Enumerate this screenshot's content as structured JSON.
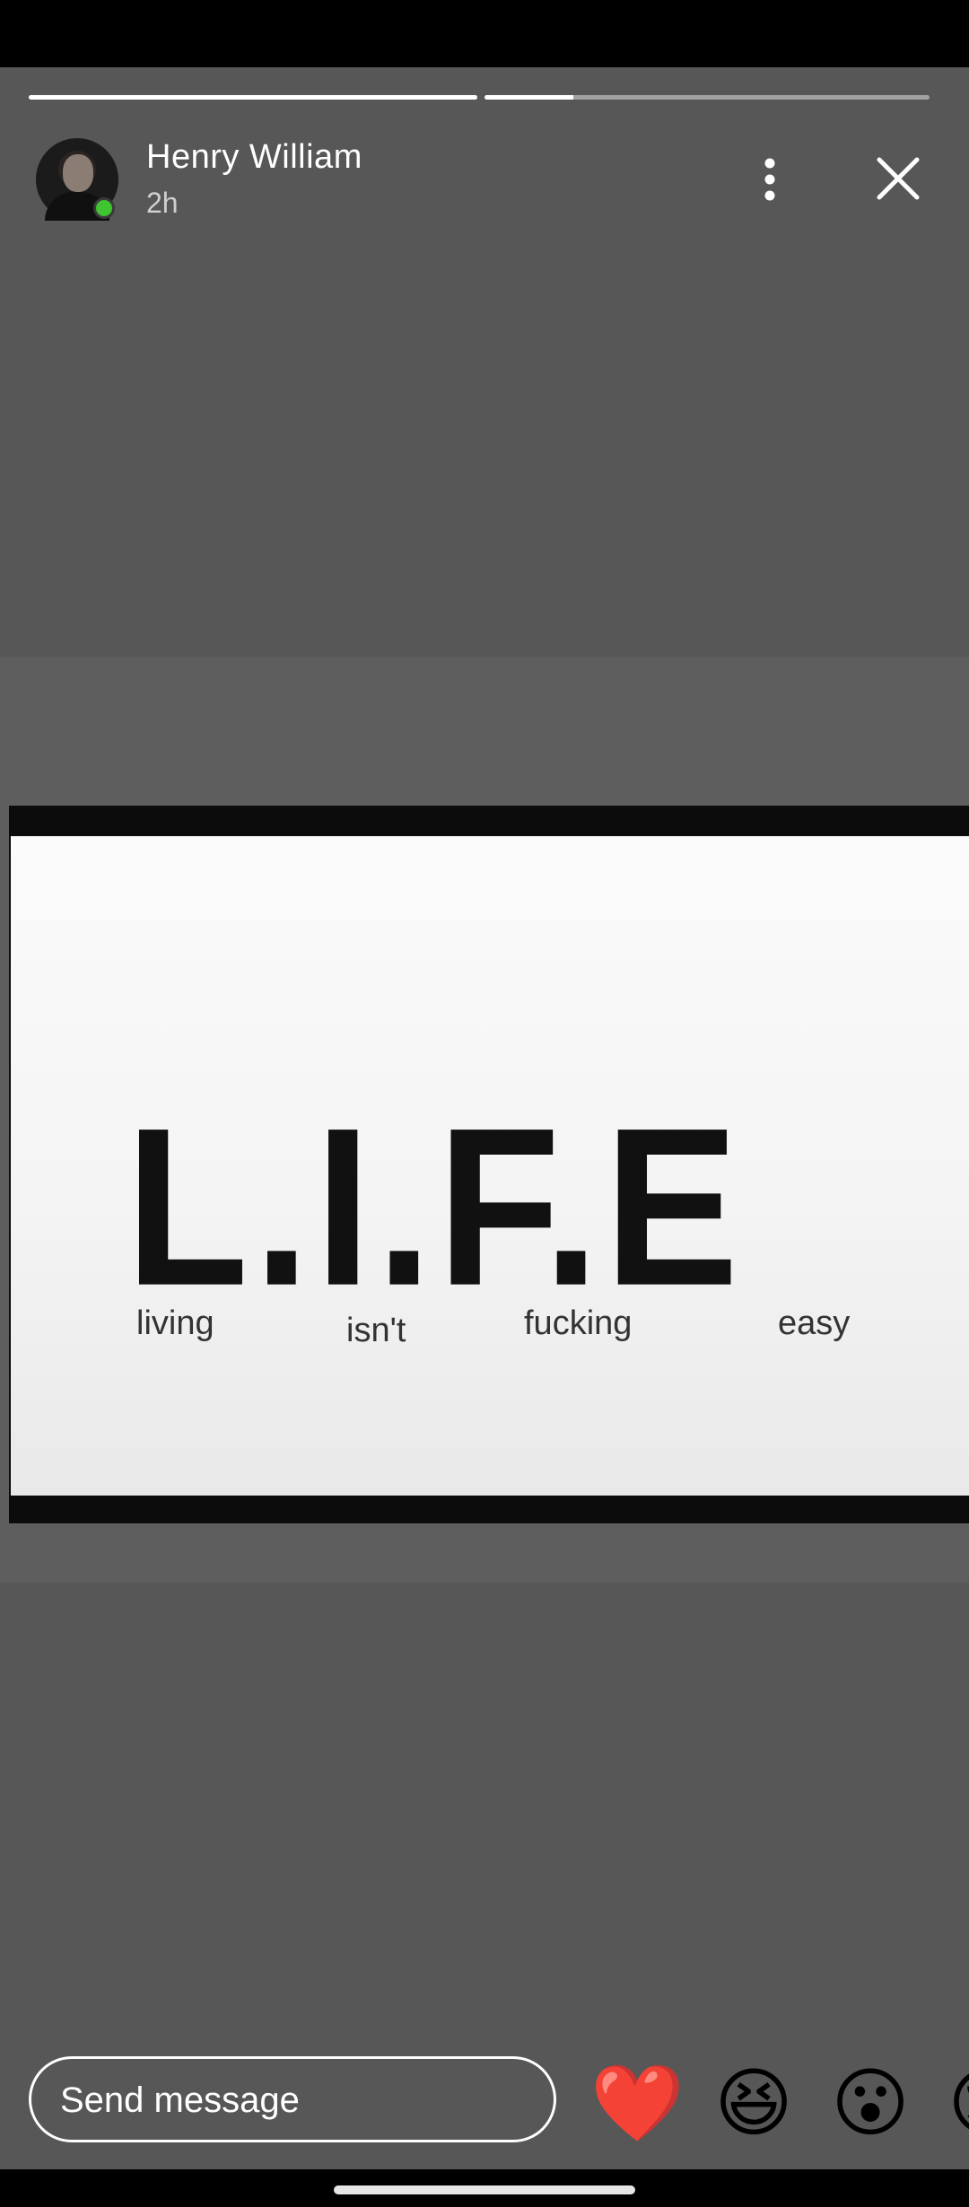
{
  "story": {
    "progress": [
      1.0,
      0.2,
      0.0
    ]
  },
  "user": {
    "name": "Henry William",
    "time": "2h",
    "online": true
  },
  "icons": {
    "more": "more-vertical-icon",
    "close": "close-icon"
  },
  "image": {
    "title": "L.I.F.E",
    "words": [
      "living",
      "isn't",
      "fucking",
      "easy"
    ]
  },
  "composer": {
    "placeholder": "Send message"
  },
  "reactions": [
    "❤️",
    "😆",
    "😮",
    "😢"
  ],
  "colors": {
    "background": "#575757",
    "online": "#3fc52f",
    "heart": "#e3192e"
  }
}
